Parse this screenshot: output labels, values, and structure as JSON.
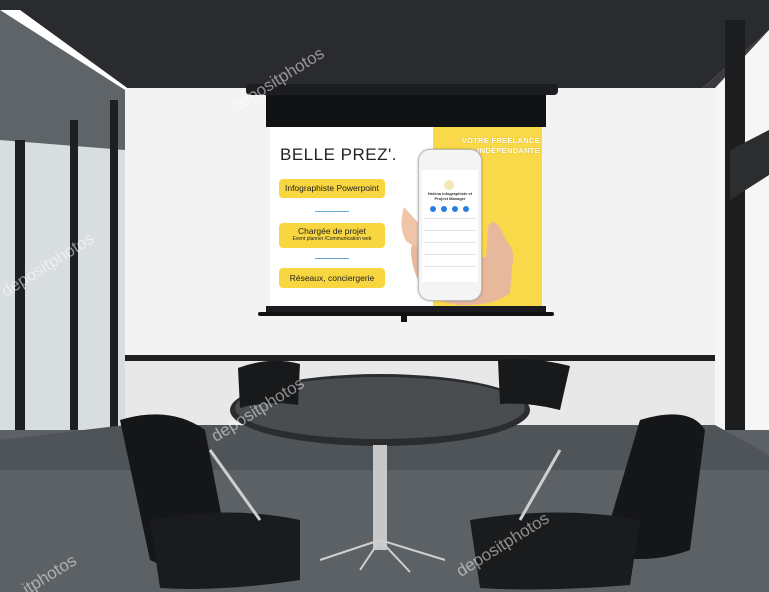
{
  "slide": {
    "title": "BELLE PREZ'.",
    "banner_line1": "VOTRE FREELANCE",
    "banner_line2": "INDÉPENDANTE",
    "pill1": "Infographiste Powerpoint",
    "pill2_title": "Chargée de projet",
    "pill2_sub": "Event planner /Communication web",
    "pill3": "Réseaux, conciergerie",
    "phone_contact_name": "Helena infographiste et Project Manager",
    "colors": {
      "yellow": "#f9d949",
      "accent_blue": "#2a7de1"
    }
  },
  "watermarks": [
    "depositphotos",
    "depositphotos",
    "depositphotos",
    "depositphotos",
    "itphotos"
  ]
}
